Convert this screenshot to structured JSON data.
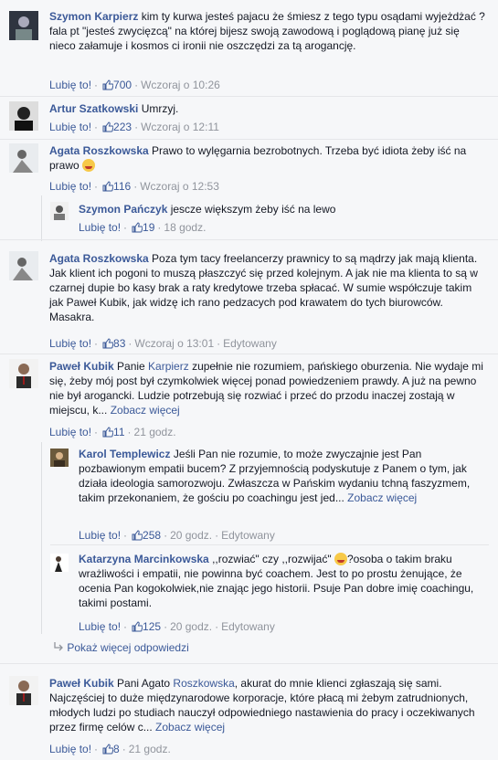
{
  "like_label": "Lubię to!",
  "comments": [
    {
      "author": "Szymon Karpierz",
      "text": " kim ty kurwa jesteś pajacu że śmiesz z tego typu osądami wyjeżdżać ? fala pt \"jesteś zwycięzcą\" na której bijesz swoją zawodową i poglądową pianę już się nieco załamuje i kosmos ci ironii nie oszczędzi za tą arogancję.",
      "likes": "700",
      "time": "Wczoraj o 10:26"
    },
    {
      "author": "Artur Szatkowski",
      "text": " Umrzyj.",
      "likes": "223",
      "time": "Wczoraj o 12:11"
    },
    {
      "author": "Agata Roszkowska",
      "text": " Prawo to wylęgarnia bezrobotnych. Trzeba być idiota żeby iść na prawo ",
      "likes": "116",
      "time": "Wczoraj o 12:53"
    },
    {
      "author": "Szymon Pańczyk",
      "text": " jescze większym żeby iść na lewo",
      "likes": "19",
      "time": "18 godz."
    },
    {
      "author": "Agata Roszkowska",
      "text": " Poza tym tacy freelancerzy prawnicy to są mądrzy jak mają klienta. Jak klient ich pogoni to muszą płaszczyć się przed kolejnym. A jak nie ma klienta to są w czarnej dupie bo kasy brak a raty kredytowe trzeba spłacać. W sumie współczuje takim jak Paweł Kubik, jak widzę ich rano pedzacych pod krawatem do tych biurowców. Masakra.",
      "likes": "83",
      "time": "Wczoraj o 13:01",
      "edited": "Edytowany"
    },
    {
      "author": "Paweł Kubik",
      "pre": " Panie ",
      "mention": "Karpierz",
      "text": " zupełnie nie rozumiem, pańskiego oburzenia. Nie wydaje mi się, żeby mój post był czymkolwiek więcej ponad powiedzeniem prawdy. A już na pewno nie był arogancki. Ludzie potrzebują się rozwiać i przeć do przodu inaczej zostają w miejscu, k... ",
      "see_more": "Zobacz więcej",
      "likes": "11",
      "time": "21 godz."
    },
    {
      "author": "Karol Templewicz",
      "text": " Jeśli Pan nie rozumie, to może zwyczajnie jest Pan pozbawionym empatii bucem? Z przyjemnością podyskutuje z Panem o tym, jak działa ideologia samorozwoju. Zwłaszcza w Pańskim wydaniu tchną faszyzmem, takim przekonaniem, że gościu po coachingu jest jed... ",
      "see_more": "Zobacz więcej",
      "likes": "258",
      "time": "20 godz.",
      "edited": "Edytowany"
    },
    {
      "author": "Katarzyna Marcinkowska",
      "text": " ,,rozwiać\" czy ,,rozwijać\" ",
      "text2": "?osoba o takim braku wrażliwości i empatii, nie powinna być coachem. Jest to po prostu żenujące, że ocenia Pan kogokolwiek,nie znając jego historii. Psuje Pan dobre imię coachingu, takimi postami.",
      "likes": "125",
      "time": "20 godz.",
      "edited": "Edytowany"
    },
    {
      "author": "Paweł Kubik",
      "pre": " Pani Agato ",
      "mention": "Roszkowska",
      "text": ", akurat do mnie klienci zgłaszają się sami. Najczęściej to duże międzynarodowe korporacje, które płacą mi żebym zatrudnionych, młodych ludzi po studiach nauczył odpowiedniego nastawienia do pracy i oczekiwanych przez firmę celów c... ",
      "see_more": "Zobacz więcej",
      "likes": "8",
      "time": "21 godz."
    }
  ],
  "more_replies": "Pokaż więcej odpowiedzi"
}
